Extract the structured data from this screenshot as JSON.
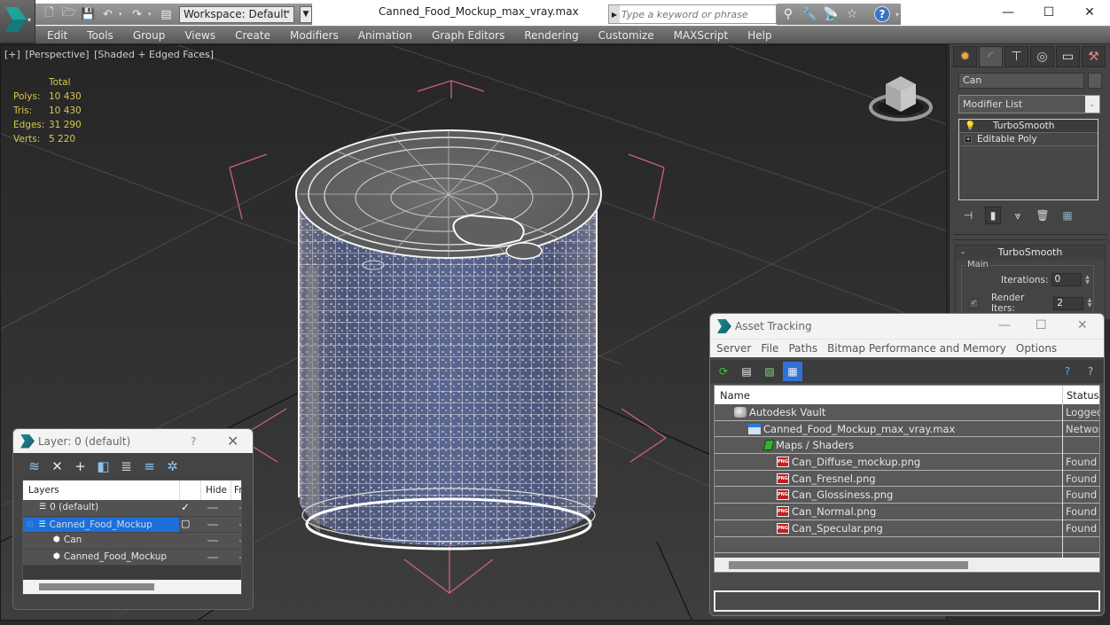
{
  "app": {
    "document_title": "Canned_Food_Mockup_max_vray.max",
    "workspace": "Workspace: Default",
    "search_placeholder": "Type a keyword or phrase",
    "window_controls": {
      "minimize": "—",
      "maximize": "☐",
      "close": "✕"
    },
    "quick_access": [
      "new-icon",
      "open-icon",
      "save-icon",
      "undo-icon",
      "redo-icon",
      "project-icon"
    ],
    "info_tools": [
      "binoculars-icon",
      "key-icon",
      "satellite-icon",
      "star-icon",
      "help-icon"
    ]
  },
  "menu": [
    "Edit",
    "Tools",
    "Group",
    "Views",
    "Create",
    "Modifiers",
    "Animation",
    "Graph Editors",
    "Rendering",
    "Customize",
    "MAXScript",
    "Help"
  ],
  "viewport": {
    "labels": [
      "[+]",
      "[Perspective]",
      "[Shaded + Edged Faces]"
    ],
    "stats": {
      "header": "Total",
      "rows": [
        {
          "label": "Polys:",
          "value": "10 430"
        },
        {
          "label": "Tris:",
          "value": "10 430"
        },
        {
          "label": "Edges:",
          "value": "31 290"
        },
        {
          "label": "Verts:",
          "value": "5 220"
        }
      ]
    }
  },
  "command_panel": {
    "tabs": [
      "create-icon",
      "modify-icon",
      "hierarchy-icon",
      "motion-icon",
      "display-icon",
      "utilities-icon"
    ],
    "active_tab": 1,
    "object_name": "Can",
    "modifier_list_label": "Modifier List",
    "stack": [
      {
        "label": "TurboSmooth",
        "selected": true
      },
      {
        "label": "Editable Poly",
        "selected": false
      }
    ],
    "rollout": {
      "title": "TurboSmooth",
      "collapse": "-",
      "group": "Main",
      "iterations_label": "Iterations:",
      "iterations_value": "0",
      "render_iters_label": "Render Iters:",
      "render_iters_value": "2",
      "render_iters_checked": true
    }
  },
  "layer_dialog": {
    "title": "Layer: 0 (default)",
    "help": "?",
    "close": "✕",
    "columns": [
      "Layers",
      "Hide",
      "Fr"
    ],
    "rows": [
      {
        "name": "0 (default)",
        "type": "layer",
        "indent": 1,
        "current": true,
        "selected": false
      },
      {
        "name": "Canned_Food_Mockup",
        "type": "layer",
        "indent": 1,
        "current": false,
        "selected": true
      },
      {
        "name": "Can",
        "type": "object",
        "indent": 2,
        "current": false,
        "selected": false
      },
      {
        "name": "Canned_Food_Mockup",
        "type": "object",
        "indent": 2,
        "current": false,
        "selected": false
      }
    ]
  },
  "asset_tracking": {
    "title": "Asset Tracking",
    "menu": [
      "Server",
      "File",
      "Paths",
      "Bitmap Performance and Memory",
      "Options"
    ],
    "columns": [
      "Name",
      "Status"
    ],
    "rows": [
      {
        "name": "Autodesk Vault",
        "icon": "vault",
        "indent": 1,
        "status": "Logged"
      },
      {
        "name": "Canned_Food_Mockup_max_vray.max",
        "icon": "max",
        "indent": 2,
        "status": "Networ"
      },
      {
        "name": "Maps / Shaders",
        "icon": "maps",
        "indent": 3,
        "status": ""
      },
      {
        "name": "Can_Diffuse_mockup.png",
        "icon": "png",
        "indent": 4,
        "status": "Found"
      },
      {
        "name": "Can_Fresnel.png",
        "icon": "png",
        "indent": 4,
        "status": "Found"
      },
      {
        "name": "Can_Glossiness.png",
        "icon": "png",
        "indent": 4,
        "status": "Found"
      },
      {
        "name": "Can_Normal.png",
        "icon": "png",
        "indent": 4,
        "status": "Found"
      },
      {
        "name": "Can_Specular.png",
        "icon": "png",
        "indent": 4,
        "status": "Found"
      }
    ]
  },
  "colors": {
    "stats_text": "#d9c84a",
    "selection_blue": "#1e6fd9",
    "gizmo_pink": "#d0607a"
  }
}
